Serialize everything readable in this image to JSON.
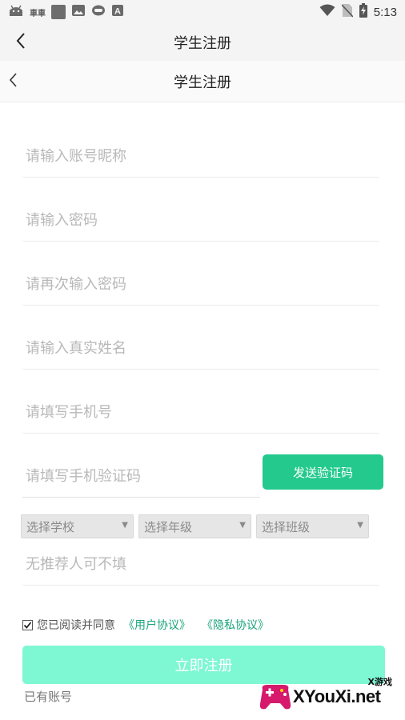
{
  "status_bar": {
    "carrier_text": "車車",
    "time": "5:13",
    "icons": [
      "android-robot-icon",
      "square-icon",
      "image-icon",
      "chat-bubble-icon",
      "a-letter-icon",
      "wifi-icon",
      "no-sim-icon",
      "battery-charging-icon"
    ]
  },
  "titlebar": {
    "title": "学生注册"
  },
  "header": {
    "title": "学生注册"
  },
  "form": {
    "nickname_placeholder": "请输入账号昵称",
    "password_placeholder": "请输入密码",
    "confirm_password_placeholder": "请再次输入密码",
    "real_name_placeholder": "请输入真实姓名",
    "phone_placeholder": "请填写手机号",
    "sms_code_placeholder": "请填写手机验证码",
    "send_code_label": "发送验证码",
    "select_school": "选择学校",
    "select_grade": "选择年级",
    "select_class": "选择班级",
    "referrer_placeholder": "无推荐人可不填"
  },
  "agreement": {
    "checked": true,
    "text": "您已阅读并同意",
    "user_agreement": "《用户协议》",
    "privacy_policy": "《隐私协议》"
  },
  "register_label": "立即注册",
  "have_account_label": "已有账号",
  "watermark": {
    "text": "XYouXi.net",
    "sub": "X游戏"
  },
  "colors": {
    "accent": "#23c98d",
    "register_button": "#7ef7d3",
    "link": "#1aa37a",
    "placeholder": "#b8b8b8"
  }
}
